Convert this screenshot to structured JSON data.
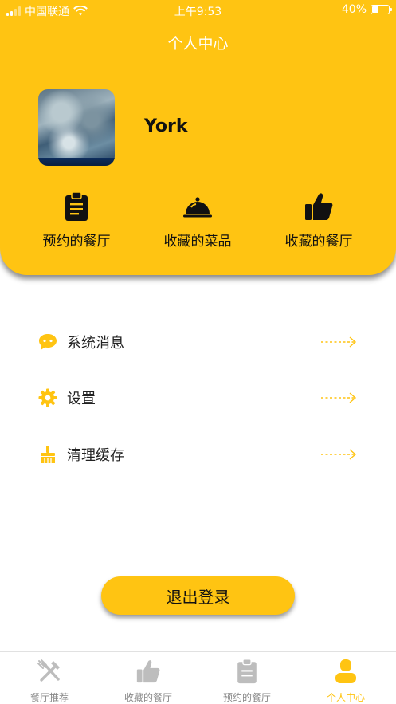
{
  "status_bar": {
    "carrier": "中国联通",
    "time": "上午9:53",
    "battery": "40%"
  },
  "header": {
    "title": "个人中心"
  },
  "profile": {
    "username": "York"
  },
  "quick_actions": [
    {
      "label": "预约的餐厅",
      "icon": "clipboard-icon"
    },
    {
      "label": "收藏的菜品",
      "icon": "dish-cloche-icon"
    },
    {
      "label": "收藏的餐厅",
      "icon": "thumbs-up-icon"
    }
  ],
  "menu": [
    {
      "label": "系统消息",
      "icon": "chat-bubble-icon"
    },
    {
      "label": "设置",
      "icon": "gear-icon"
    },
    {
      "label": "清理缓存",
      "icon": "broom-icon"
    }
  ],
  "logout_label": "退出登录",
  "tabs": [
    {
      "label": "餐厅推荐",
      "icon": "fork-knife-icon",
      "active": false
    },
    {
      "label": "收藏的餐厅",
      "icon": "thumbs-up-icon",
      "active": false
    },
    {
      "label": "预约的餐厅",
      "icon": "clipboard-icon",
      "active": false
    },
    {
      "label": "个人中心",
      "icon": "person-icon",
      "active": true
    }
  ],
  "colors": {
    "accent": "#FFC412",
    "inactive": "#888888",
    "text": "#111111"
  }
}
